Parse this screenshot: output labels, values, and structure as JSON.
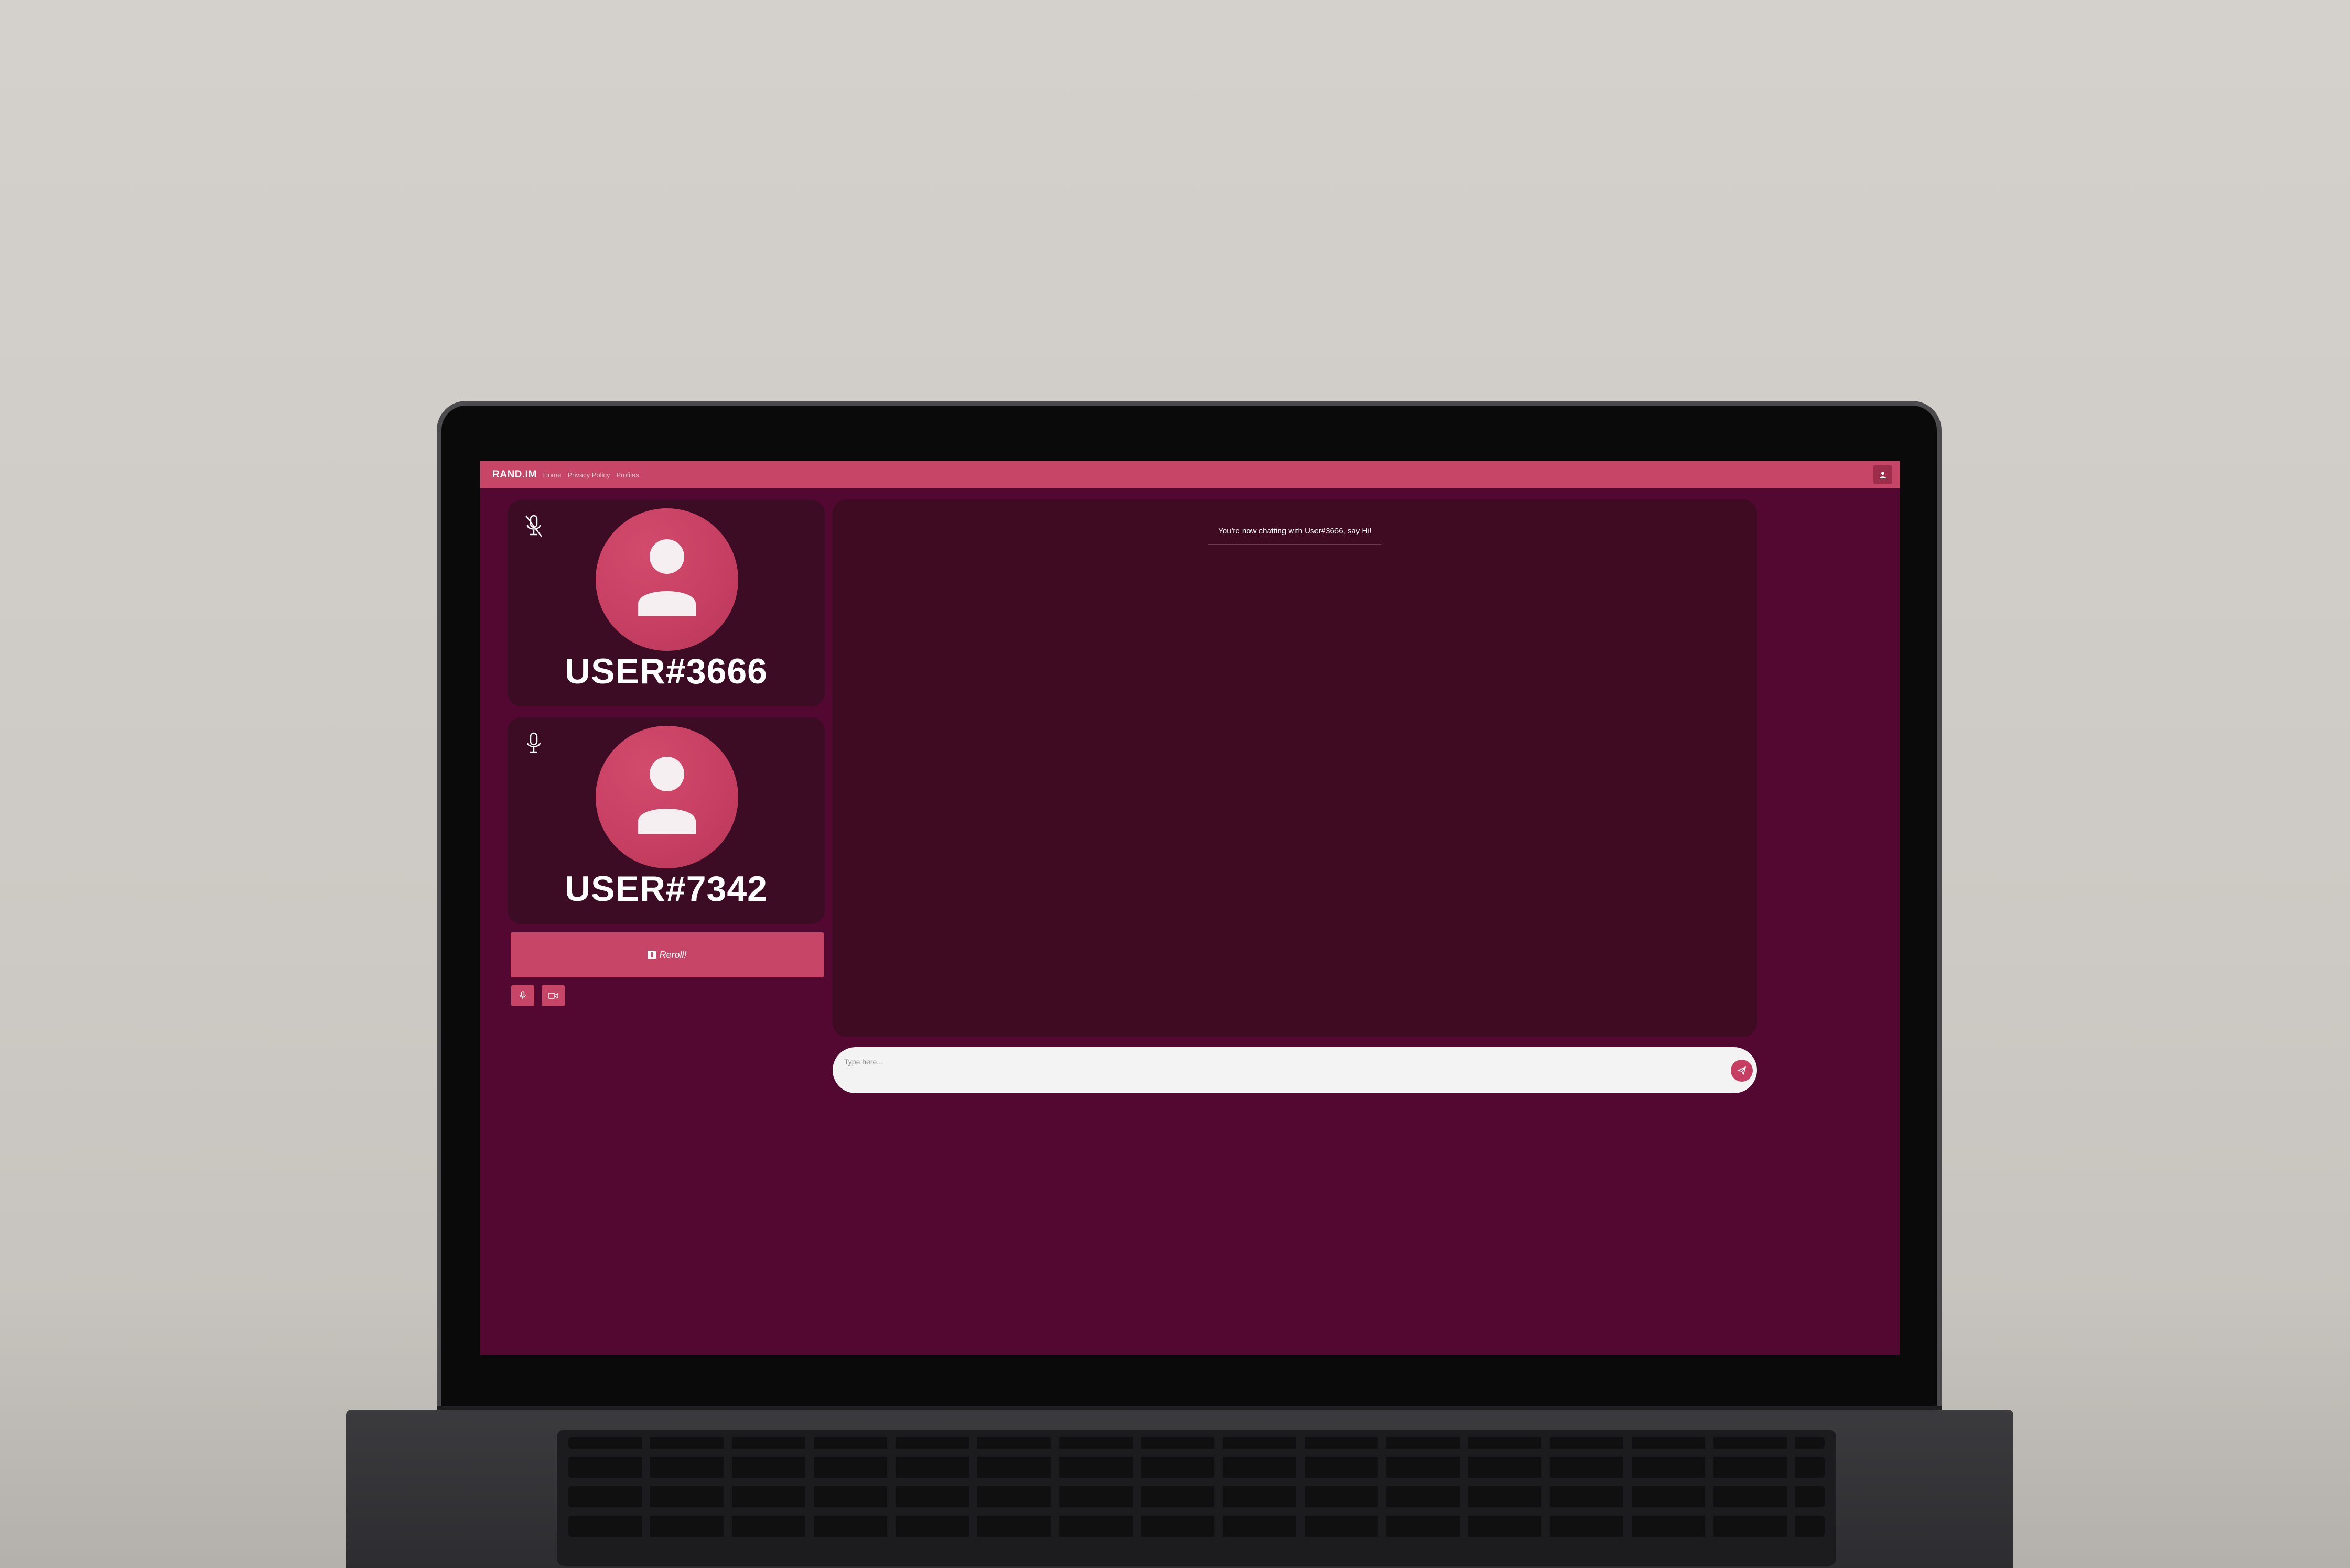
{
  "navbar": {
    "brand": "RAND.IM",
    "links": [
      "Home",
      "Privacy Policy",
      "Profiles"
    ],
    "profile_icon": "user-icon"
  },
  "users": [
    {
      "name": "USER#3666",
      "mic_state": "muted",
      "mic_icon": "mic-off-icon"
    },
    {
      "name": "USER#7342",
      "mic_state": "on",
      "mic_icon": "mic-icon"
    }
  ],
  "controls": {
    "reroll_label": "Reroll!",
    "reroll_icon": "dice-icon",
    "mic_button_icon": "mic-icon",
    "camera_button_icon": "video-camera-icon"
  },
  "chat": {
    "messages": [
      "You're now chatting with User#3666, say Hi!"
    ],
    "input_placeholder": "Type here...",
    "input_value": "",
    "send_icon": "send-icon"
  },
  "colors": {
    "accent": "#c74567",
    "background": "#520830",
    "card": "#3b0c24",
    "chat_panel": "#3e0b22"
  }
}
